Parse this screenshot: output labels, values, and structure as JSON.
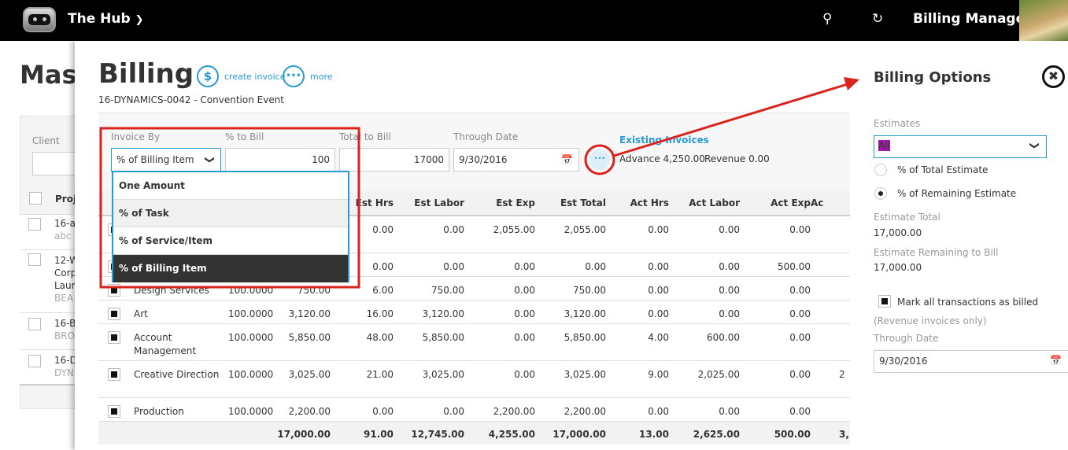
{
  "topbar": {
    "app_name": "The Hub",
    "user": "Billing Manager"
  },
  "background_page": {
    "title_partial": "Mass",
    "client_label": "Client",
    "col_project_partial": "Proj",
    "rows": [
      [
        "16-a",
        "abc"
      ],
      [
        "12-W",
        "Corp",
        "Laur",
        "BEA"
      ],
      [
        "16-B",
        "BRO"
      ],
      [
        "16-D",
        "DYN"
      ]
    ]
  },
  "billing": {
    "title": "Billing",
    "create_invoice": "create invoice",
    "more": "more",
    "subtitle": "16-DYNAMICS-0042 - Convention Event",
    "filters": {
      "invoice_by_label": "Invoice By",
      "invoice_by_value": "% of Billing Item",
      "pct_label": "% to Bill",
      "pct_value": "100",
      "total_label": "Total to Bill",
      "total_value": "17000",
      "date_label": "Through Date",
      "date_value": "9/30/2016"
    },
    "existing": {
      "link": "Existing Invoices",
      "advance": "Advance 4,250.00",
      "revenue": "Revenue 0.00"
    },
    "dropdown_options": [
      "One Amount",
      "% of Task",
      "% of Service/Item",
      "% of Billing Item"
    ],
    "table": {
      "headers": [
        "Est Hrs",
        "Est Labor",
        "Est Exp",
        "Est Total",
        "Act Hrs",
        "Act Labor",
        "Act Exp",
        "Ac"
      ],
      "rows": [
        {
          "name": "",
          "pct": "",
          "amount": "",
          "v": [
            "0.00",
            "0.00",
            "2,055.00",
            "2,055.00",
            "0.00",
            "0.00",
            "0.00",
            ""
          ]
        },
        {
          "name": "",
          "pct": "",
          "amount": "",
          "v": [
            "0.00",
            "0.00",
            "0.00",
            "0.00",
            "0.00",
            "0.00",
            "500.00",
            ""
          ]
        },
        {
          "name": "Design Services",
          "pct": "100.0000",
          "amount": "750.00",
          "v": [
            "6.00",
            "750.00",
            "0.00",
            "750.00",
            "0.00",
            "0.00",
            "0.00",
            ""
          ]
        },
        {
          "name": "Art",
          "pct": "100.0000",
          "amount": "3,120.00",
          "v": [
            "16.00",
            "3,120.00",
            "0.00",
            "3,120.00",
            "0.00",
            "0.00",
            "0.00",
            ""
          ]
        },
        {
          "name": "Account Management",
          "pct": "100.0000",
          "amount": "5,850.00",
          "v": [
            "48.00",
            "5,850.00",
            "0.00",
            "5,850.00",
            "4.00",
            "600.00",
            "0.00",
            ""
          ]
        },
        {
          "name": "Creative Direction",
          "pct": "100.0000",
          "amount": "3,025.00",
          "v": [
            "21.00",
            "3,025.00",
            "0.00",
            "3,025.00",
            "9.00",
            "2,025.00",
            "0.00",
            "2"
          ]
        },
        {
          "name": "Production",
          "pct": "100.0000",
          "amount": "2,200.00",
          "v": [
            "0.00",
            "0.00",
            "2,200.00",
            "2,200.00",
            "0.00",
            "0.00",
            "0.00",
            ""
          ]
        }
      ],
      "totals": [
        "17,000.00",
        "91.00",
        "12,745.00",
        "4,255.00",
        "17,000.00",
        "13.00",
        "2,625.00",
        "500.00",
        "3,"
      ]
    }
  },
  "options": {
    "title": "Billing Options",
    "estimates_label": "Estimates",
    "estimates_value": "All",
    "radio_total": "% of Total Estimate",
    "radio_remaining": "% of Remaining Estimate",
    "est_total_label": "Estimate Total",
    "est_total": "17,000.00",
    "remaining_label": "Estimate Remaining to Bill",
    "remaining": "17,000.00",
    "mark_billed": "Mark all transactions as billed",
    "revenue_only": "(Revenue invoices only)",
    "date_label": "Through Date",
    "date_value": "9/30/2016"
  },
  "colors": {
    "accent": "#2a9ad6",
    "annotation": "#d9231d",
    "selected_option": "#333333"
  }
}
